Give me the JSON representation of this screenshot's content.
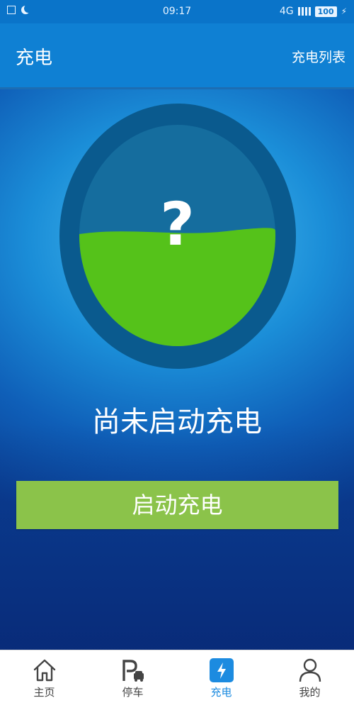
{
  "status_bar": {
    "time": "09:17",
    "network": "4G",
    "battery": "100"
  },
  "header": {
    "title": "充电",
    "action_label": "充电列表"
  },
  "gauge": {
    "symbol": "?",
    "fill_level": 0.5,
    "fill_color": "#55c21a",
    "ring_color": "#0a5a8e"
  },
  "charging": {
    "status": "尚未启动充电",
    "start_button_label": "启动充电"
  },
  "bottom_nav": {
    "items": [
      {
        "label": "主页",
        "icon": "home-icon",
        "active": false
      },
      {
        "label": "停车",
        "icon": "parking-icon",
        "active": false
      },
      {
        "label": "充电",
        "icon": "charging-bolt-icon",
        "active": true
      },
      {
        "label": "我的",
        "icon": "user-icon",
        "active": false
      }
    ]
  },
  "colors": {
    "primary": "#0f80d3",
    "accent_active": "#1c8be0",
    "button_green": "#8bc34a"
  }
}
